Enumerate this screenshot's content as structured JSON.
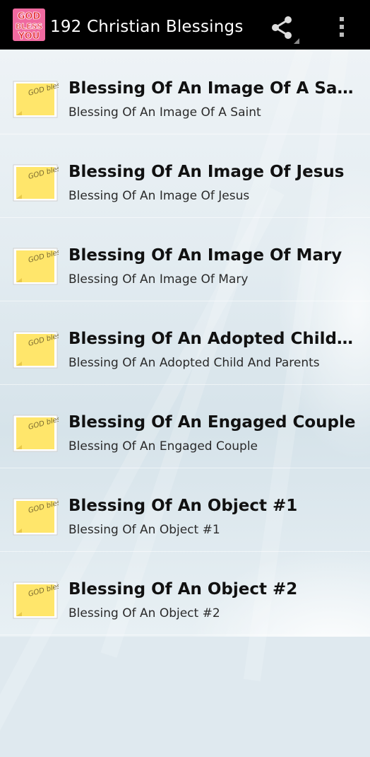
{
  "app": {
    "title": "192 Christian Blessings",
    "logo_text": [
      "GOD",
      "BLESS",
      "YOU"
    ]
  },
  "icons": {
    "share": "share-icon",
    "overflow": "more-vert-icon"
  },
  "colors": {
    "appbar": "#000000",
    "logo_red": "#e0141c",
    "logo_pink": "#f06aa0",
    "note_yellow": "#ffe66b"
  },
  "note_text": "GOD bless you!",
  "items": [
    {
      "title": "Blessing Of An Image Of A Saint",
      "subtitle": "Blessing Of An Image Of A Saint"
    },
    {
      "title": "Blessing Of An Image Of Jesus",
      "subtitle": "Blessing Of An Image Of Jesus"
    },
    {
      "title": "Blessing Of An Image Of Mary",
      "subtitle": "Blessing Of An Image Of Mary"
    },
    {
      "title": "Blessing Of An Adopted Child And Parents",
      "subtitle": "Blessing Of An Adopted Child And Parents"
    },
    {
      "title": "Blessing Of An Engaged Couple",
      "subtitle": "Blessing Of An Engaged Couple"
    },
    {
      "title": "Blessing Of An Object #1",
      "subtitle": "Blessing Of An Object #1"
    },
    {
      "title": "Blessing Of An Object #2",
      "subtitle": "Blessing Of An Object #2"
    }
  ]
}
